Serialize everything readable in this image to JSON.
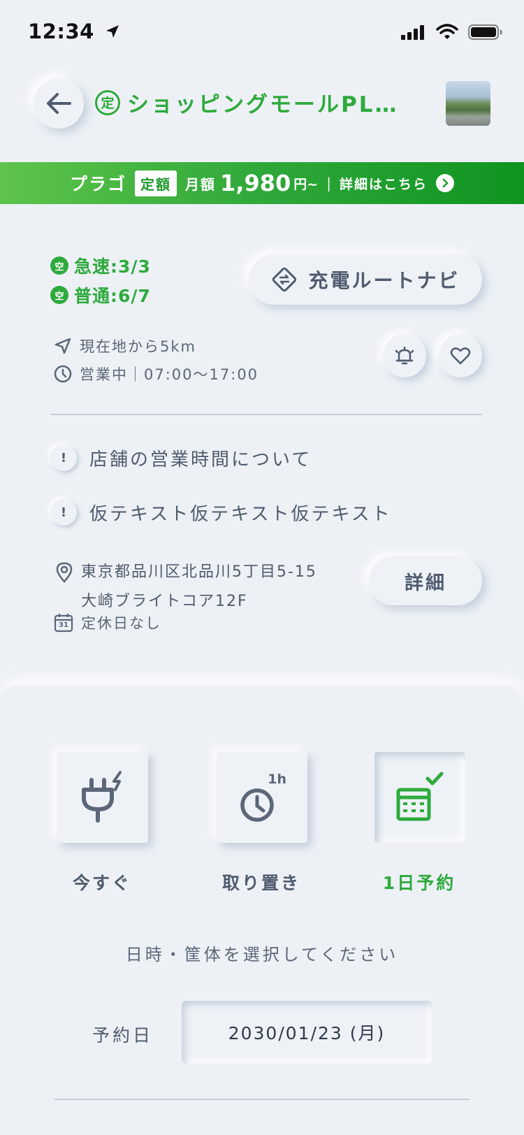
{
  "status_bar": {
    "time": "12:34"
  },
  "header": {
    "store_badge": "定",
    "store_name": "ショッピングモールPL…"
  },
  "plan_banner": {
    "plan_name": "プラゴ",
    "plan_type": "定額",
    "price_label": "月額",
    "price": "1,980",
    "price_unit": "円~",
    "separator": "|",
    "detail_link": "詳細はこちら"
  },
  "availability": {
    "badge": "空",
    "rapid": "急速:3/3",
    "normal": "普通:6/7"
  },
  "route_navi_label": "充電ルートナビ",
  "distance": "現在地から5km",
  "hours": "営業中｜07:00～17:00",
  "notices": [
    {
      "mark": "!",
      "text": "店舗の営業時間について"
    },
    {
      "mark": "!",
      "text": "仮テキスト仮テキスト仮テキスト"
    }
  ],
  "address": {
    "line1": "東京都品川区北品川5丁目5-15",
    "line2": "大崎ブライトコア12F"
  },
  "closed_days": "定休日なし",
  "calendar_day": "31",
  "detail_button": "詳細",
  "modes": [
    {
      "label": "今すぐ",
      "icon": "plug-icon",
      "selected": false
    },
    {
      "label": "取り置き",
      "icon": "timer-1h-icon",
      "badge": "1h",
      "selected": false
    },
    {
      "label": "1日予約",
      "icon": "calendar-check-icon",
      "selected": true
    }
  ],
  "prompt": "日時・筐体を選択してください",
  "reservation": {
    "date_label": "予約日",
    "date_value": "2030/01/23 (月)"
  },
  "colors": {
    "accent": "#2eaa3c",
    "background": "#edf1f6",
    "text": "#4f5b6e"
  }
}
